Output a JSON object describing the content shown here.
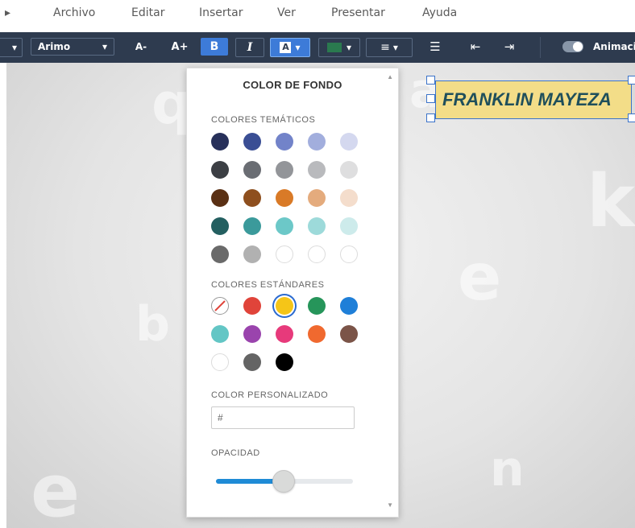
{
  "menu": {
    "partial_left": "▸",
    "items": [
      "Archivo",
      "Editar",
      "Insertar",
      "Ver",
      "Presentar",
      "Ayuda"
    ]
  },
  "toolbar": {
    "font_name": "Arimo",
    "decrease_font": "A-",
    "increase_font": "A+",
    "bold": "B",
    "italic": "I",
    "highlight": "A",
    "animation_label": "Animaci"
  },
  "slide": {
    "title_text": "FRANKLIN MAYEZA",
    "title_bg": "#f3dd88",
    "title_color": "#1f4f5b"
  },
  "popup": {
    "title": "COLOR DE FONDO",
    "theme_label": "COLORES TEMÁTICOS",
    "standard_label": "COLORES ESTÁNDARES",
    "custom_label": "COLOR PERSONALIZADO",
    "hex_value": "#",
    "opacity_label": "OPACIDAD",
    "opacity_value": 0.5,
    "selected_color": "#f5c518",
    "theme_colors": [
      [
        "#27305a",
        "#3a4e94",
        "#7283c9",
        "#a2aedd",
        "#d4d8ef"
      ],
      [
        "#3c3f44",
        "#6a6d73",
        "#939599",
        "#b9babd",
        "#dededf"
      ],
      [
        "#5a3014",
        "#8e4f1e",
        "#d97a27",
        "#e4ab7d",
        "#f4ddcc"
      ],
      [
        "#235f60",
        "#3b9a9b",
        "#6cc8c8",
        "#9ddada",
        "#cdebeb"
      ],
      [
        "#6a6a6a",
        "#b1b1b1",
        "#ffffff",
        "#ffffff",
        "#ffffff"
      ]
    ],
    "standard_colors": [
      [
        "none",
        "#e0443a",
        "#f5c518",
        "#26955a",
        "#1f7fd8"
      ],
      [
        "#63c6c5",
        "#9a44ad",
        "#e73a7b",
        "#f0692f",
        "#7b5448"
      ],
      [
        "#ffffff",
        "#646464",
        "#000000"
      ]
    ]
  }
}
